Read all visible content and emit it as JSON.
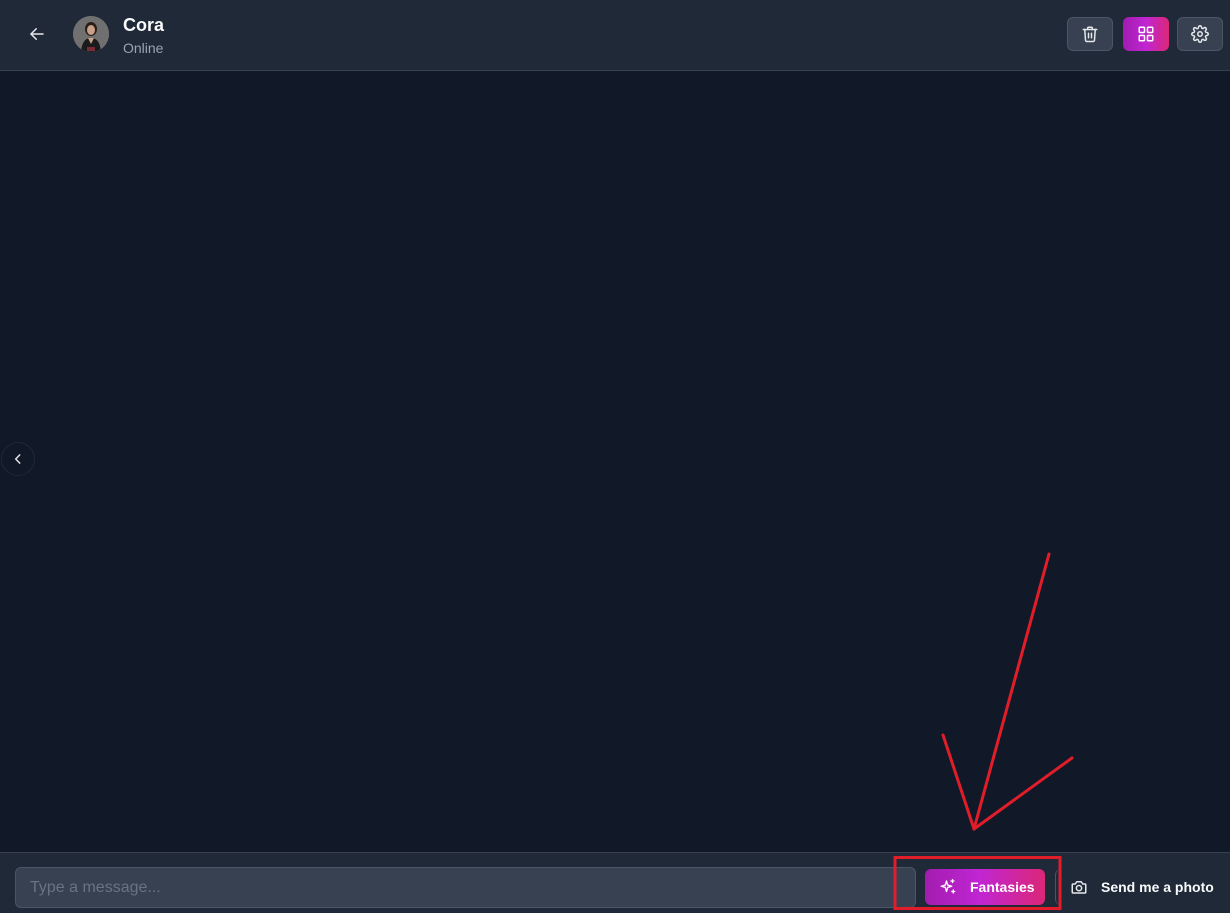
{
  "header": {
    "contact_name": "Cora",
    "contact_status": "Online",
    "icons": {
      "back": "arrow-left-icon",
      "delete": "trash-icon",
      "gallery": "grid-icon",
      "settings": "gear-icon"
    }
  },
  "side_toggle": {
    "icon": "chevron-left-icon"
  },
  "composer": {
    "message_placeholder": "Type a message...",
    "message_value": "",
    "fantasies_label": "Fantasies",
    "fantasies_icon": "sparkles-icon",
    "photo_label": "Send me a photo",
    "photo_icon": "camera-icon"
  },
  "colors": {
    "background": "#111827",
    "header_bg": "#1f2937",
    "accent_start": "#a21caf",
    "accent_end": "#db2777",
    "annotation_red": "#e11d2a"
  }
}
